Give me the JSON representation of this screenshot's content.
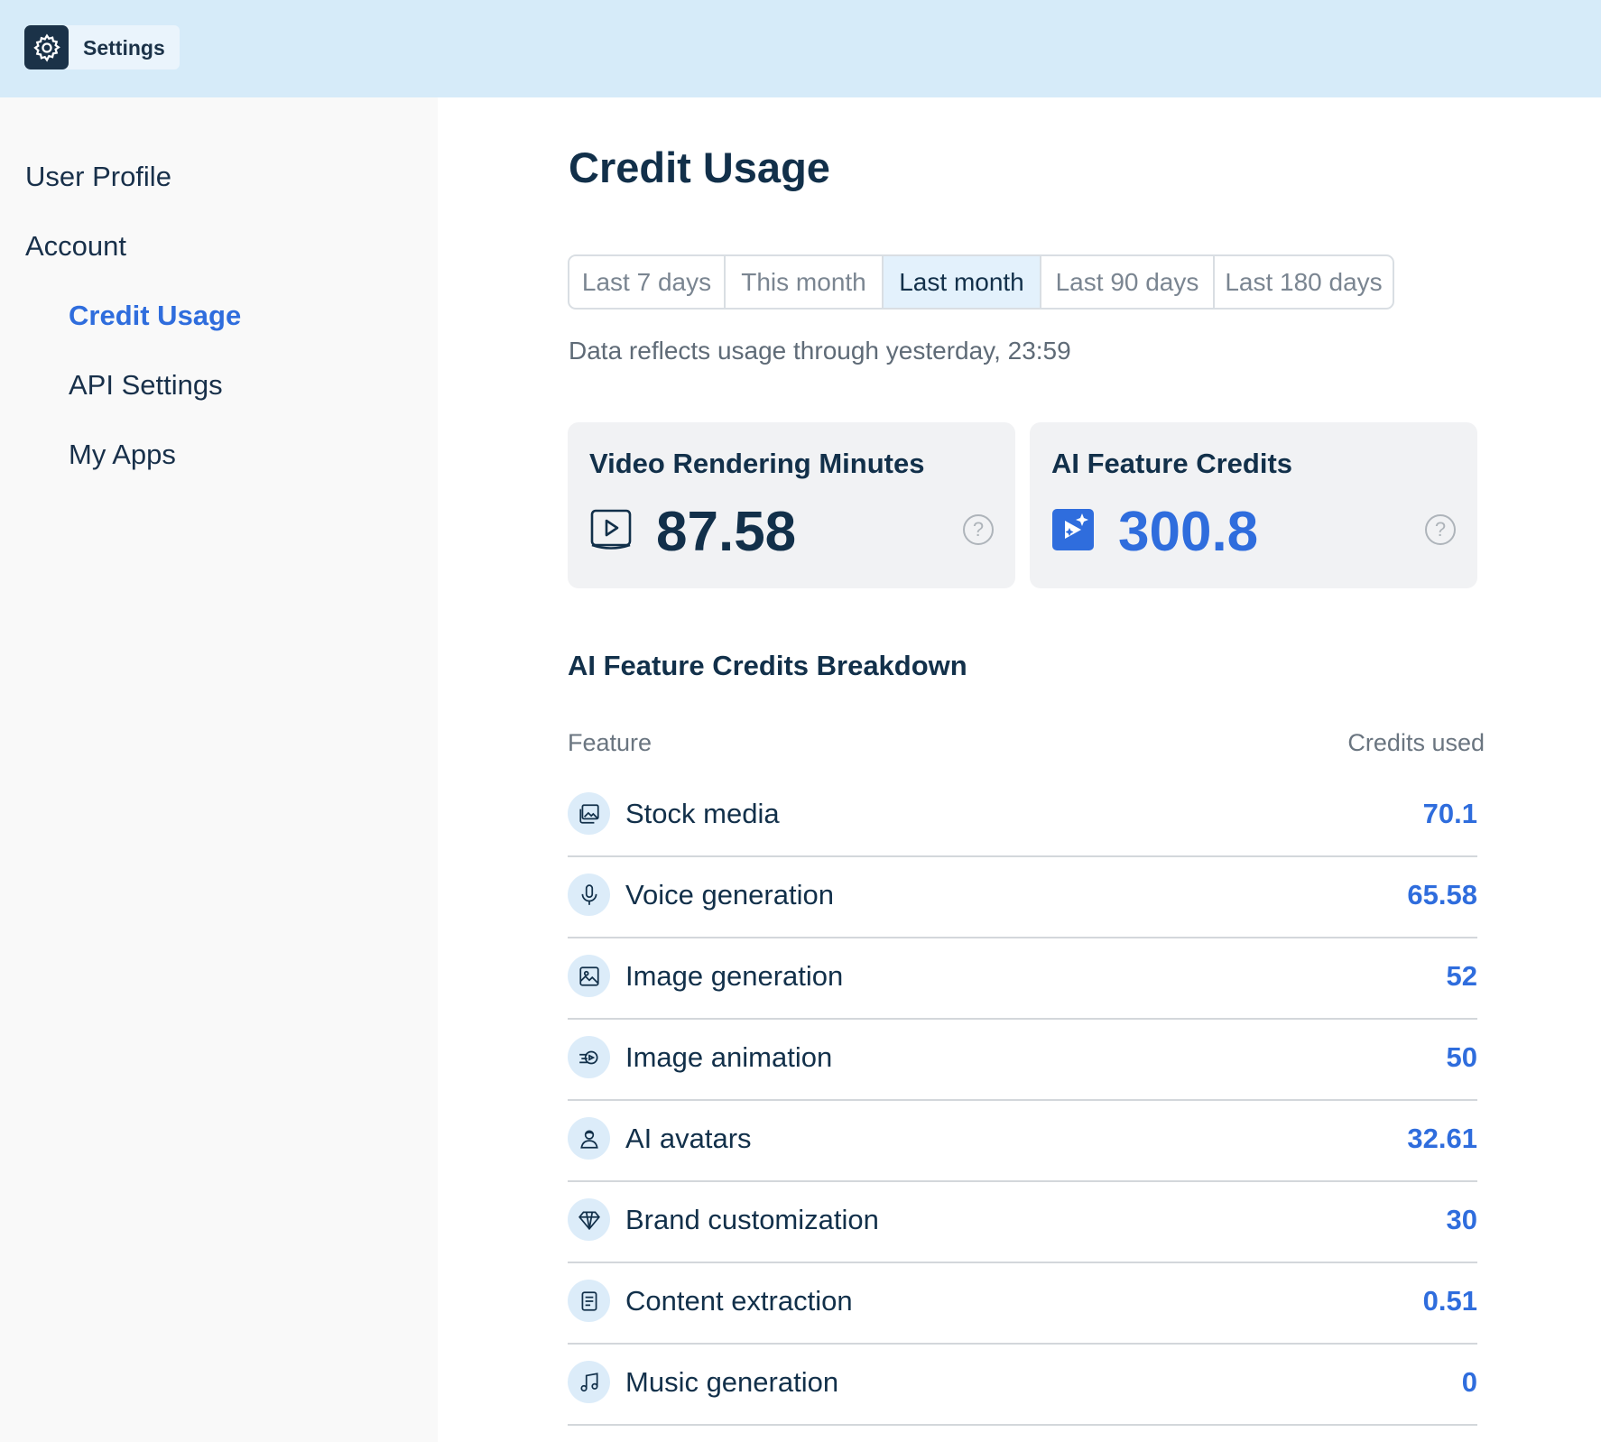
{
  "header": {
    "title": "Settings",
    "icon": "gear-icon"
  },
  "sidebar": {
    "items": [
      {
        "label": "User Profile"
      },
      {
        "label": "Account"
      },
      {
        "label": "Credit Usage",
        "active": true
      },
      {
        "label": "API Settings"
      },
      {
        "label": "My Apps"
      }
    ]
  },
  "main": {
    "title": "Credit Usage",
    "tabs": [
      {
        "label": "Last 7 days"
      },
      {
        "label": "This month"
      },
      {
        "label": "Last month",
        "selected": true
      },
      {
        "label": "Last 90 days"
      },
      {
        "label": "Last 180 days"
      }
    ],
    "data_note": "Data reflects usage through yesterday, 23:59",
    "cards": [
      {
        "title": "Video Rendering Minutes",
        "value": "87.58",
        "icon": "video-play-icon",
        "value_color": "#12304a"
      },
      {
        "title": "AI Feature Credits",
        "value": "300.8",
        "icon": "ai-sparkle-icon",
        "value_color": "#2f6ddd"
      }
    ],
    "help_glyph": "?",
    "breakdown": {
      "title": "AI Feature Credits Breakdown",
      "col_feature": "Feature",
      "col_credits": "Credits used",
      "rows": [
        {
          "label": "Stock media",
          "value": "70.1",
          "icon": "stock-media-icon"
        },
        {
          "label": "Voice generation",
          "value": "65.58",
          "icon": "microphone-icon"
        },
        {
          "label": "Image generation",
          "value": "52",
          "icon": "image-icon"
        },
        {
          "label": "Image animation",
          "value": "50",
          "icon": "animation-icon"
        },
        {
          "label": "AI avatars",
          "value": "32.61",
          "icon": "avatar-icon"
        },
        {
          "label": "Brand customization",
          "value": "30",
          "icon": "diamond-icon"
        },
        {
          "label": "Content extraction",
          "value": "0.51",
          "icon": "document-icon"
        },
        {
          "label": "Music generation",
          "value": "0",
          "icon": "music-note-icon"
        }
      ]
    }
  },
  "colors": {
    "accent": "#2f6ddd",
    "topbar": "#d6ebf9",
    "dark": "#12304a"
  }
}
